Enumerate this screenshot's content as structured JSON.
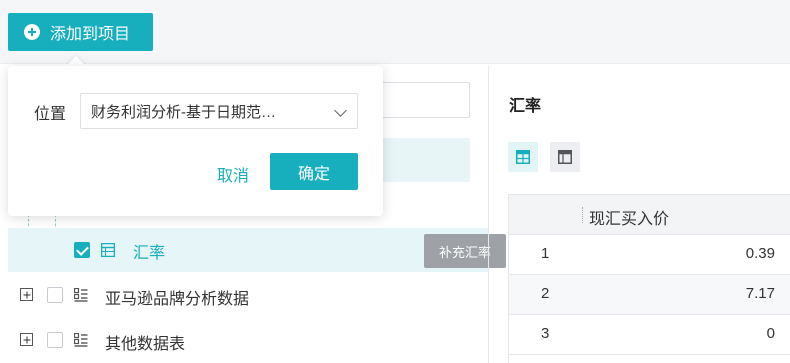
{
  "toolbar": {
    "add_button_label": "添加到项目"
  },
  "popover": {
    "position_label": "位置",
    "position_value": "财务利润分析-基于日期范…",
    "cancel_label": "取消",
    "confirm_label": "确定"
  },
  "tree": {
    "items": [
      {
        "label": "汇率",
        "checked": true,
        "selected": true
      },
      {
        "label": "亚马逊品牌分析数据",
        "checked": false,
        "selected": false
      },
      {
        "label": "其他数据表",
        "checked": false,
        "selected": false
      }
    ]
  },
  "tooltip": {
    "text": "补充汇率"
  },
  "preview": {
    "title": "汇率",
    "table": {
      "column": "现汇买入价",
      "rows": [
        {
          "index": "1",
          "value": "0.39"
        },
        {
          "index": "2",
          "value": "7.17"
        },
        {
          "index": "3",
          "value": "0"
        }
      ]
    }
  },
  "colors": {
    "accent": "#17aebd"
  }
}
